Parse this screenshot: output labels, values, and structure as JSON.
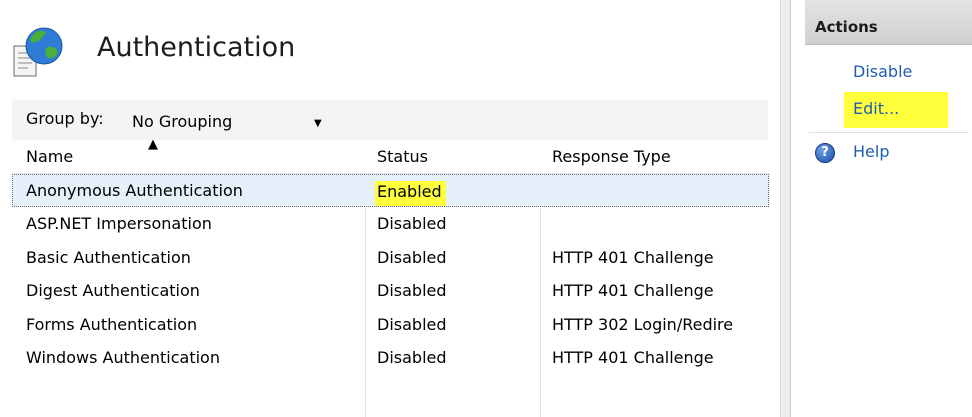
{
  "feature": {
    "title": "Authentication",
    "icon": "globe-document-icon"
  },
  "group_by": {
    "label": "Group by:",
    "value": "No Grouping"
  },
  "columns": {
    "name": "Name",
    "status": "Status",
    "response_type": "Response Type"
  },
  "rows": [
    {
      "name": "Anonymous Authentication",
      "status": "Enabled",
      "response_type": ""
    },
    {
      "name": "ASP.NET Impersonation",
      "status": "Disabled",
      "response_type": ""
    },
    {
      "name": "Basic Authentication",
      "status": "Disabled",
      "response_type": "HTTP 401 Challenge"
    },
    {
      "name": "Digest Authentication",
      "status": "Disabled",
      "response_type": "HTTP 401 Challenge"
    },
    {
      "name": "Forms Authentication",
      "status": "Disabled",
      "response_type": "HTTP 302 Login/Redire"
    },
    {
      "name": "Windows Authentication",
      "status": "Disabled",
      "response_type": "HTTP 401 Challenge"
    }
  ],
  "actions": {
    "title": "Actions",
    "disable": "Disable",
    "edit": "Edit...",
    "help": "Help",
    "help_icon": "question-circle-icon"
  },
  "colors": {
    "highlight": "#ffff3c",
    "link": "#1e5eb0",
    "selection": "#e5f0fb"
  }
}
